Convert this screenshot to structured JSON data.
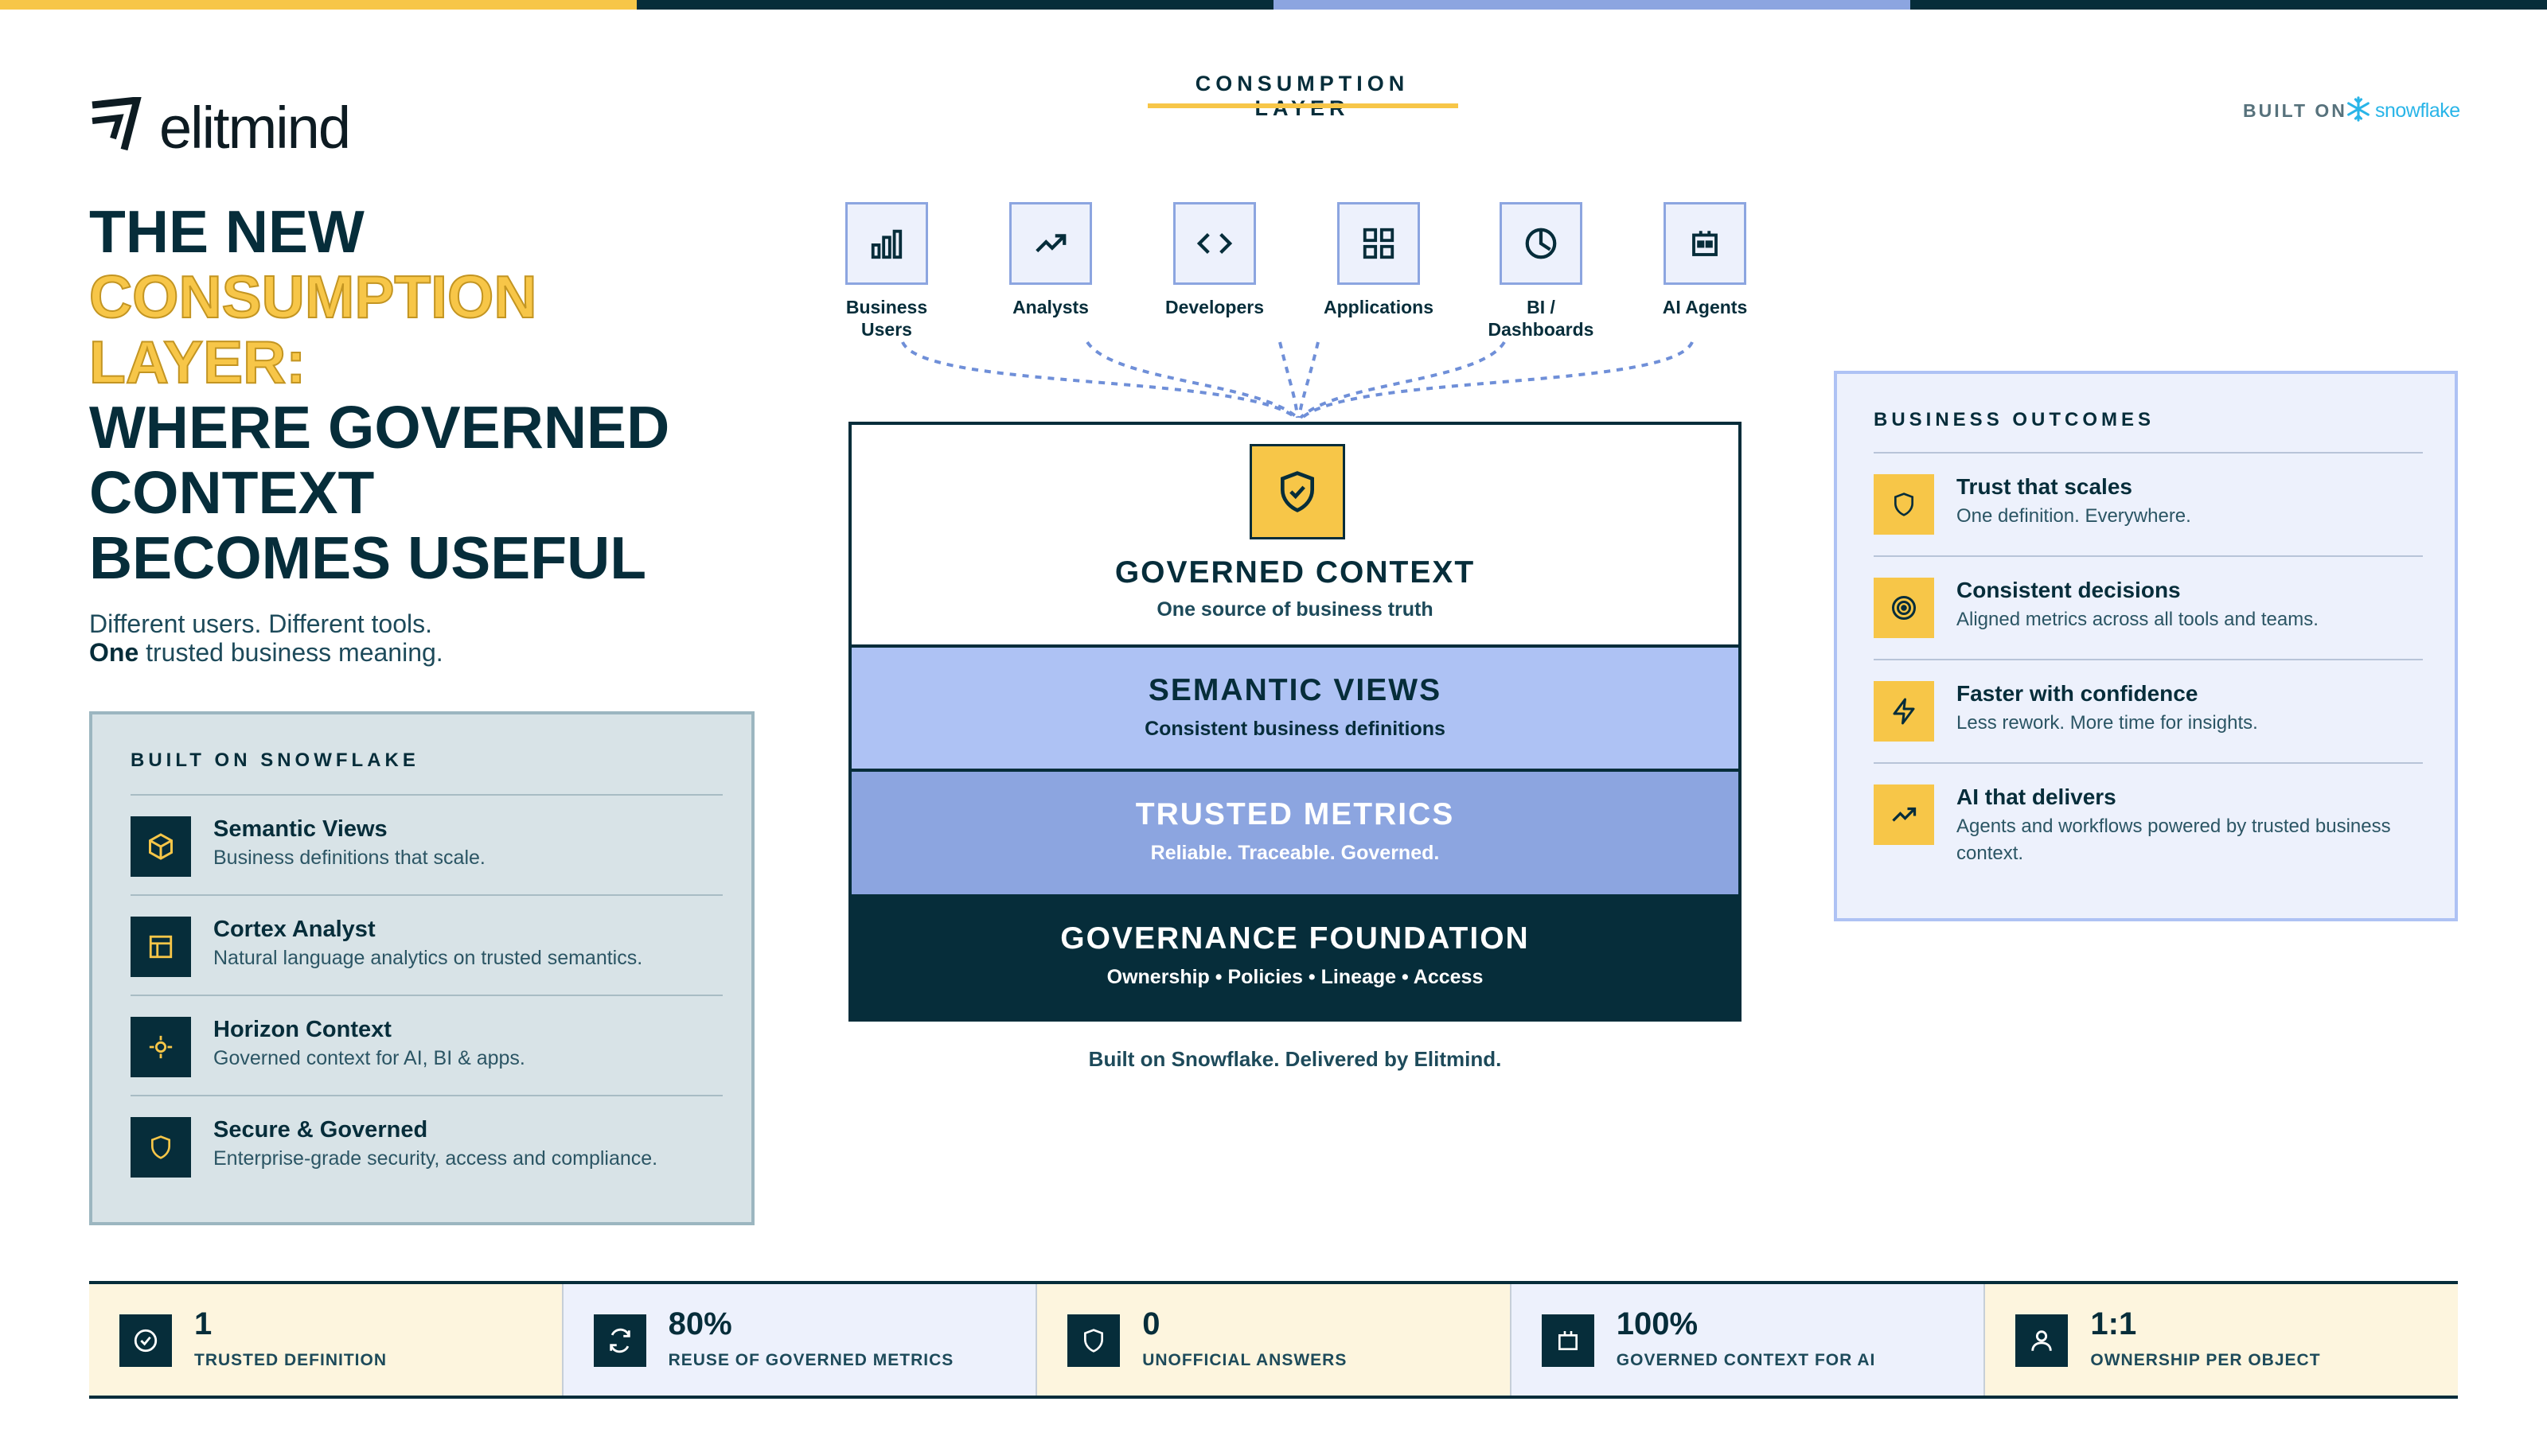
{
  "colors": {
    "navy": "#062d3a",
    "yellow": "#f7c648",
    "periwinkle": "#8ca5e0",
    "light_periwinkle": "#aec2f4",
    "snowflake_blue": "#29b5e8"
  },
  "logo": {
    "text": "elitmind",
    "icon": "elitmind-logo-mark"
  },
  "headline": {
    "line1": "THE NEW",
    "accent1": "CONSUMPTION",
    "accent2": "LAYER:",
    "line2": "WHERE GOVERNED",
    "line3": "CONTEXT",
    "line4": "BECOMES USEFUL"
  },
  "subheadline": {
    "line1": "Different users. Different tools.",
    "bold": "One",
    "line2_rest": " trusted business meaning."
  },
  "built_on_panel": {
    "title": "BUILT ON SNOWFLAKE",
    "items": [
      {
        "title": "Semantic Views",
        "desc": "Business definitions that scale.",
        "icon": "cube-icon"
      },
      {
        "title": "Cortex Analyst",
        "desc": "Natural language analytics on trusted semantics.",
        "icon": "layout-icon"
      },
      {
        "title": "Horizon Context",
        "desc": "Governed context for AI, BI & apps.",
        "icon": "target-crosshair-icon"
      },
      {
        "title": "Secure & Governed",
        "desc": "Enterprise-grade security, access and compliance.",
        "icon": "shield-icon"
      }
    ]
  },
  "consumption": {
    "heading": "CONSUMPTION LAYER",
    "built_on_label": "BUILT ON",
    "snowflake_text": "snowflake",
    "users": [
      {
        "label_l1": "Business",
        "label_l2": "Users",
        "icon": "bar-chart-icon"
      },
      {
        "label_l1": "Analysts",
        "label_l2": "",
        "icon": "trend-up-icon"
      },
      {
        "label_l1": "Developers",
        "label_l2": "",
        "icon": "code-icon"
      },
      {
        "label_l1": "Applications",
        "label_l2": "",
        "icon": "grid-icon"
      },
      {
        "label_l1": "BI /",
        "label_l2": "Dashboards",
        "icon": "clock-pie-icon"
      },
      {
        "label_l1": "AI Agents",
        "label_l2": "",
        "icon": "robot-icon"
      }
    ]
  },
  "stack": {
    "governed_context": {
      "title": "GOVERNED CONTEXT",
      "sub": "One source of business truth"
    },
    "semantic_views": {
      "title": "SEMANTIC VIEWS",
      "sub": "Consistent business definitions"
    },
    "trusted_metrics": {
      "title": "TRUSTED METRICS",
      "sub": "Reliable. Traceable. Governed."
    },
    "foundation": {
      "title": "GOVERNANCE FOUNDATION",
      "sub": "Ownership • Policies • Lineage • Access"
    },
    "tagline": "Built on Snowflake. Delivered by Elitmind."
  },
  "outcomes": {
    "title": "BUSINESS OUTCOMES",
    "items": [
      {
        "title": "Trust that scales",
        "desc": "One definition. Everywhere.",
        "icon": "shield-icon"
      },
      {
        "title": "Consistent decisions",
        "desc": "Aligned metrics across all tools and teams.",
        "icon": "target-icon"
      },
      {
        "title": "Faster with confidence",
        "desc": "Less rework. More time for insights.",
        "icon": "lightning-icon"
      },
      {
        "title": "AI that delivers",
        "desc": "Agents and workflows powered by trusted business context.",
        "icon": "trend-up-icon"
      }
    ]
  },
  "stats": [
    {
      "value": "1",
      "label": "TRUSTED DEFINITION",
      "icon": "check-circle-icon",
      "bg": "#fdf5de"
    },
    {
      "value": "80%",
      "label": "REUSE OF GOVERNED METRICS",
      "icon": "refresh-icon",
      "bg": "#edf1fc"
    },
    {
      "value": "0",
      "label": "UNOFFICIAL ANSWERS",
      "icon": "shield-icon",
      "bg": "#fdf5de"
    },
    {
      "value": "100%",
      "label": "GOVERNED CONTEXT FOR AI",
      "icon": "robot-icon",
      "bg": "#edf1fc"
    },
    {
      "value": "1:1",
      "label": "OWNERSHIP PER OBJECT",
      "icon": "user-icon",
      "bg": "#fdf5de"
    }
  ]
}
